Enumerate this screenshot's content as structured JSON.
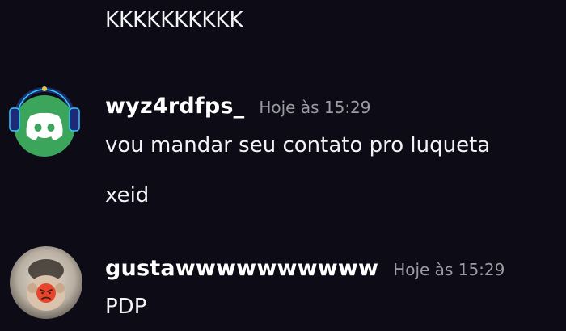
{
  "chat": {
    "previous_message": {
      "text": "KKKKKKKKKK"
    },
    "messages": [
      {
        "username": "wyz4rdfps_",
        "timestamp": "Hoje às 15:29",
        "avatar_icon": "discord-logo-icon",
        "avatar_color": "#3ba55c",
        "lines": [
          "vou mandar seu contato pro luqueta",
          "xeid"
        ]
      },
      {
        "username": "gustawwwwwwwwww",
        "timestamp": "Hoje às 15:29",
        "avatar_icon": "profile-photo-avatar",
        "lines": [
          "PDP"
        ]
      }
    ]
  },
  "colors": {
    "background": "#0c0b16",
    "text": "#f2f3f5",
    "username": "#ffffff",
    "timestamp": "#9b9ca4",
    "discord_green": "#3ba55c"
  }
}
